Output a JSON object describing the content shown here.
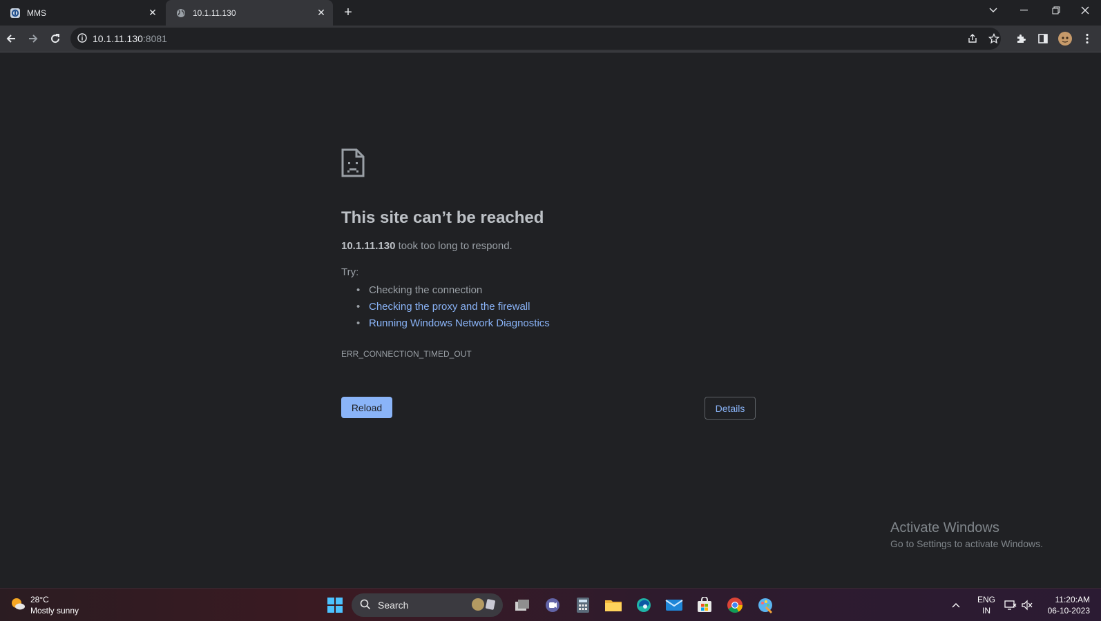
{
  "tabs": [
    {
      "title": "MMS",
      "active": false
    },
    {
      "title": "10.1.11.130",
      "active": true
    }
  ],
  "omnibox": {
    "host": "10.1.11.130",
    "port": ":8081"
  },
  "error": {
    "heading": "This site can’t be reached",
    "host": "10.1.11.130",
    "message": " took too long to respond.",
    "try_label": "Try:",
    "suggestions": [
      {
        "text": "Checking the connection",
        "link": false
      },
      {
        "text": "Checking the proxy and the firewall",
        "link": true
      },
      {
        "text": "Running Windows Network Diagnostics",
        "link": true
      }
    ],
    "code": "ERR_CONNECTION_TIMED_OUT",
    "reload_label": "Reload",
    "details_label": "Details"
  },
  "watermark": {
    "title": "Activate Windows",
    "subtitle": "Go to Settings to activate Windows."
  },
  "taskbar": {
    "weather_temp": "28°C",
    "weather_desc": "Mostly sunny",
    "search_label": "Search",
    "lang": "ENG",
    "region": "IN",
    "time": "11:20:AM",
    "date": "06-10-2023"
  },
  "colors": {
    "link": "#8ab4f8",
    "background": "#202124",
    "toolbar": "#35363a"
  }
}
